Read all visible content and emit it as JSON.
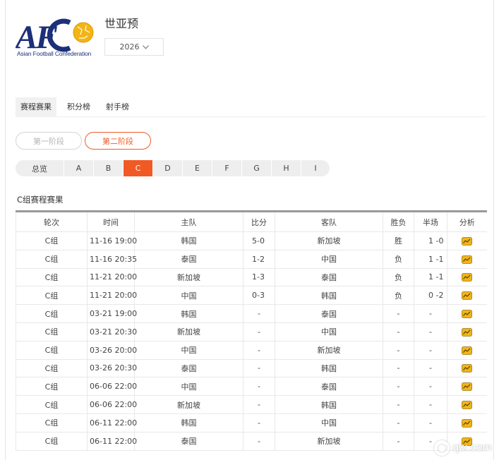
{
  "logo": {
    "text": "AFC",
    "subtitle": "Asian Football Confederation",
    "color_text": "#1c2f78",
    "color_ball": "#f2b516"
  },
  "competition": {
    "title": "世亚预",
    "season": "2026"
  },
  "main_tabs": [
    {
      "label": "赛程赛果",
      "active": true
    },
    {
      "label": "积分榜",
      "active": false
    },
    {
      "label": "射手榜",
      "active": false
    }
  ],
  "stages": [
    {
      "label": "第一阶段",
      "active": false
    },
    {
      "label": "第二阶段",
      "active": true
    }
  ],
  "groups": [
    {
      "label": "总览",
      "active": false
    },
    {
      "label": "A",
      "active": false
    },
    {
      "label": "B",
      "active": false
    },
    {
      "label": "C",
      "active": true
    },
    {
      "label": "D",
      "active": false
    },
    {
      "label": "E",
      "active": false
    },
    {
      "label": "F",
      "active": false
    },
    {
      "label": "G",
      "active": false
    },
    {
      "label": "H",
      "active": false
    },
    {
      "label": "I",
      "active": false
    }
  ],
  "section_title": "C组赛程赛果",
  "table": {
    "headers": [
      "轮次",
      "时间",
      "主队",
      "比分",
      "客队",
      "胜负",
      "半场",
      "分析"
    ],
    "rows": [
      {
        "round": "C组",
        "time": "11-16 19:00",
        "home": "韩国",
        "score": "5-0",
        "away": "新加坡",
        "result": "胜",
        "half": "1 -0"
      },
      {
        "round": "C组",
        "time": "11-16 20:35",
        "home": "泰国",
        "score": "1-2",
        "away": "中国",
        "result": "负",
        "half": "1 -1"
      },
      {
        "round": "C组",
        "time": "11-21 20:00",
        "home": "新加坡",
        "score": "1-3",
        "away": "泰国",
        "result": "负",
        "half": "1 -1"
      },
      {
        "round": "C组",
        "time": "11-21 20:00",
        "home": "中国",
        "score": "0-3",
        "away": "韩国",
        "result": "负",
        "half": "0 -2"
      },
      {
        "round": "C组",
        "time": "03-21 19:00",
        "home": "韩国",
        "score": "-",
        "away": "泰国",
        "result": "-",
        "half": "-"
      },
      {
        "round": "C组",
        "time": "03-21 20:30",
        "home": "新加坡",
        "score": "-",
        "away": "中国",
        "result": "-",
        "half": "-"
      },
      {
        "round": "C组",
        "time": "03-26 20:00",
        "home": "中国",
        "score": "-",
        "away": "新加坡",
        "result": "-",
        "half": "-"
      },
      {
        "round": "C组",
        "time": "03-26 20:30",
        "home": "泰国",
        "score": "-",
        "away": "韩国",
        "result": "-",
        "half": "-"
      },
      {
        "round": "C组",
        "time": "06-06 22:00",
        "home": "中国",
        "score": "-",
        "away": "泰国",
        "result": "-",
        "half": "-"
      },
      {
        "round": "C组",
        "time": "06-06 22:00",
        "home": "新加坡",
        "score": "-",
        "away": "韩国",
        "result": "-",
        "half": "-"
      },
      {
        "round": "C组",
        "time": "06-11 22:00",
        "home": "韩国",
        "score": "-",
        "away": "中国",
        "result": "-",
        "half": "-"
      },
      {
        "round": "C组",
        "time": "06-11 22:00",
        "home": "泰国",
        "score": "-",
        "away": "新加坡",
        "result": "-",
        "half": "-"
      }
    ],
    "analysis_icon": "chart-analysis-icon"
  },
  "watermark": {
    "text": "qtx.com"
  },
  "colors": {
    "accent": "#f15a24",
    "icon_fill": "#f2b516"
  }
}
